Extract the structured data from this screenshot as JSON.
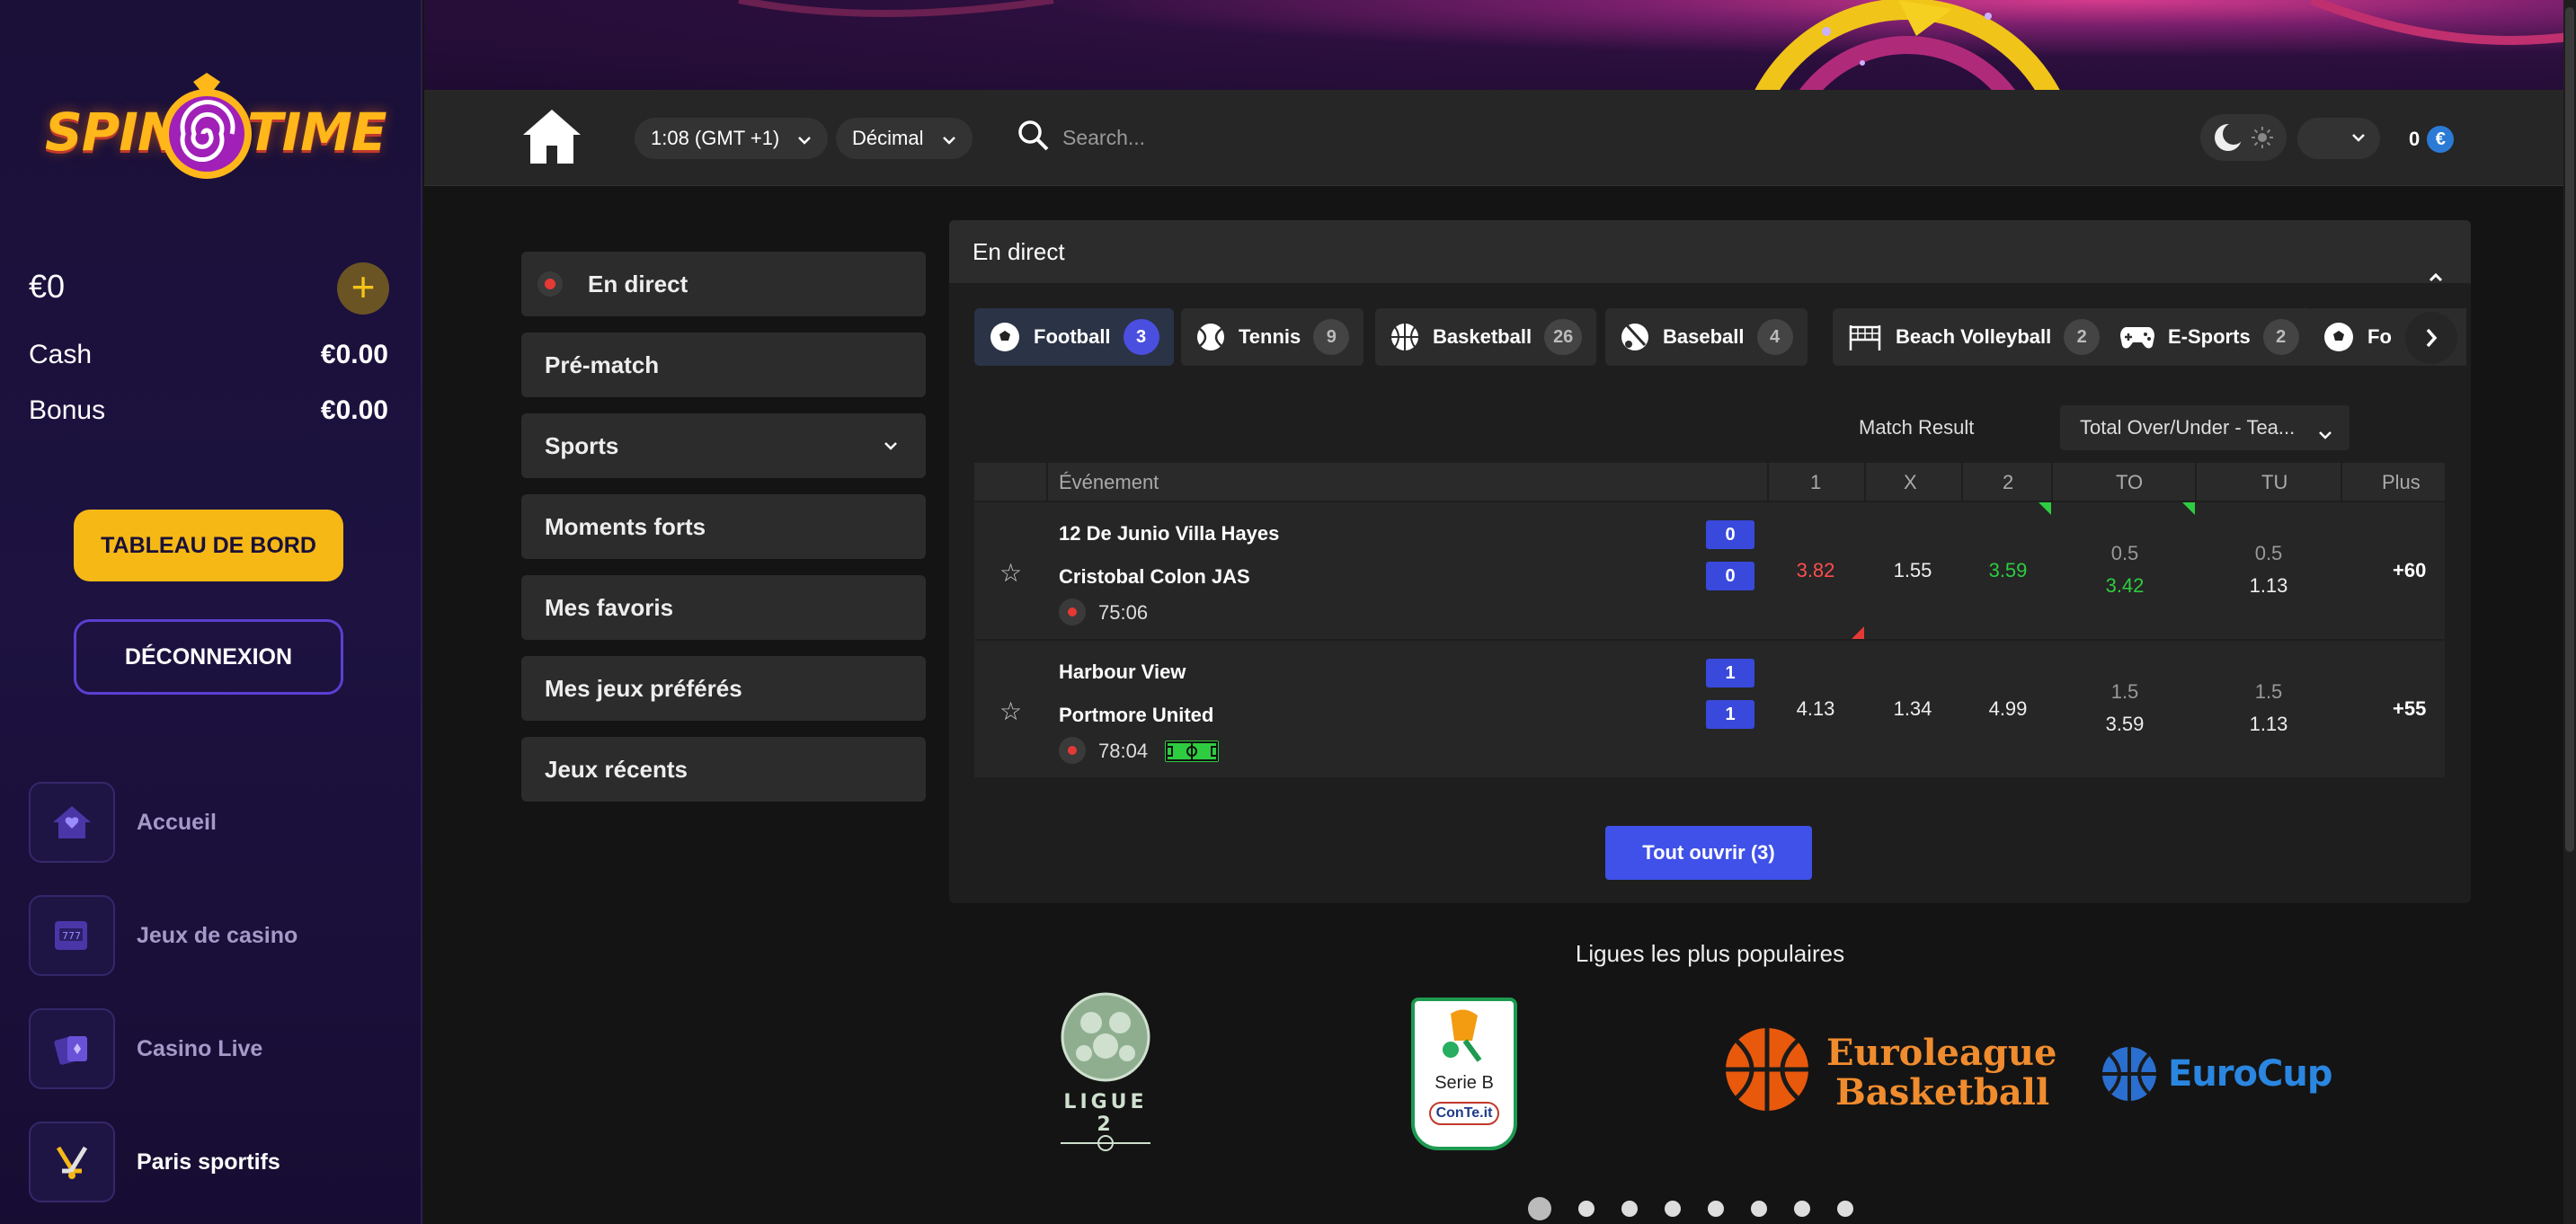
{
  "brand": {
    "logo_left": "SPIN",
    "logo_right": "TIME"
  },
  "balance": {
    "amount": "€0",
    "cash_label": "Cash",
    "cash_value": "€0.00",
    "bonus_label": "Bonus",
    "bonus_value": "€0.00"
  },
  "sidebar": {
    "dashboard_label": "TABLEAU DE BORD",
    "logout_label": "DÉCONNEXION",
    "items": [
      {
        "label": "Accueil",
        "icon": "home-icon"
      },
      {
        "label": "Jeux de casino",
        "icon": "slot-machine-icon"
      },
      {
        "label": "Casino Live",
        "icon": "cards-icon"
      },
      {
        "label": "Paris sportifs",
        "icon": "hockey-sticks-icon"
      }
    ]
  },
  "header": {
    "timezone": "1:08  (GMT +1)",
    "odds_format": "Décimal",
    "search_placeholder": "Search...",
    "wallet_amount": "0",
    "wallet_currency": "€"
  },
  "menu": [
    {
      "label": "En direct"
    },
    {
      "label": "Pré-match"
    },
    {
      "label": "Sports"
    },
    {
      "label": "Moments forts"
    },
    {
      "label": "Mes favoris"
    },
    {
      "label": "Mes jeux préférés"
    },
    {
      "label": "Jeux récents"
    }
  ],
  "live": {
    "title": "En direct",
    "tabs": [
      {
        "label": "Football",
        "count": "3"
      },
      {
        "label": "Tennis",
        "count": "9"
      },
      {
        "label": "Basketball",
        "count": "26"
      },
      {
        "label": "Baseball",
        "count": "4"
      },
      {
        "label": "Beach Volleyball",
        "count": "2"
      },
      {
        "label": "E-Sports",
        "count": "2"
      },
      {
        "label": "Fo"
      }
    ],
    "market_label": "Match Result",
    "market_select": "Total Over/Under - Tea...",
    "columns": {
      "event": "Événement",
      "c1": "1",
      "cx": "X",
      "c2": "2",
      "to": "TO",
      "tu": "TU",
      "more": "Plus"
    },
    "matches": [
      {
        "home": "12 De Junio Villa Hayes",
        "away": "Cristobal Colon JAS",
        "home_score": "0",
        "away_score": "0",
        "time": "75:06",
        "o1": "3.82",
        "ox": "1.55",
        "o2": "3.59",
        "to_line": "0.5",
        "to_odd": "3.42",
        "tu_line": "0.5",
        "tu_odd": "1.13",
        "more": "+60"
      },
      {
        "home": "Harbour View",
        "away": "Portmore United",
        "home_score": "1",
        "away_score": "1",
        "time": "78:04",
        "o1": "4.13",
        "ox": "1.34",
        "o2": "4.99",
        "to_line": "1.5",
        "to_odd": "3.59",
        "tu_line": "1.5",
        "tu_odd": "1.13",
        "more": "+55"
      }
    ],
    "open_all": "Tout ouvrir (3)"
  },
  "leagues": {
    "title": "Ligues les plus populaires",
    "items": [
      {
        "label": "LIGUE 2"
      },
      {
        "line1": "Serie B",
        "line2": "ConTe.it"
      },
      {
        "line1": "Euroleague",
        "line2": "Basketball"
      },
      {
        "label": "EuroCup"
      }
    ]
  },
  "colors": {
    "accent": "#3f51e8",
    "brand_yellow": "#f5b815",
    "live_red": "#e53935",
    "odd_up": "#2ecc40",
    "odd_down": "#ff4d4d"
  }
}
